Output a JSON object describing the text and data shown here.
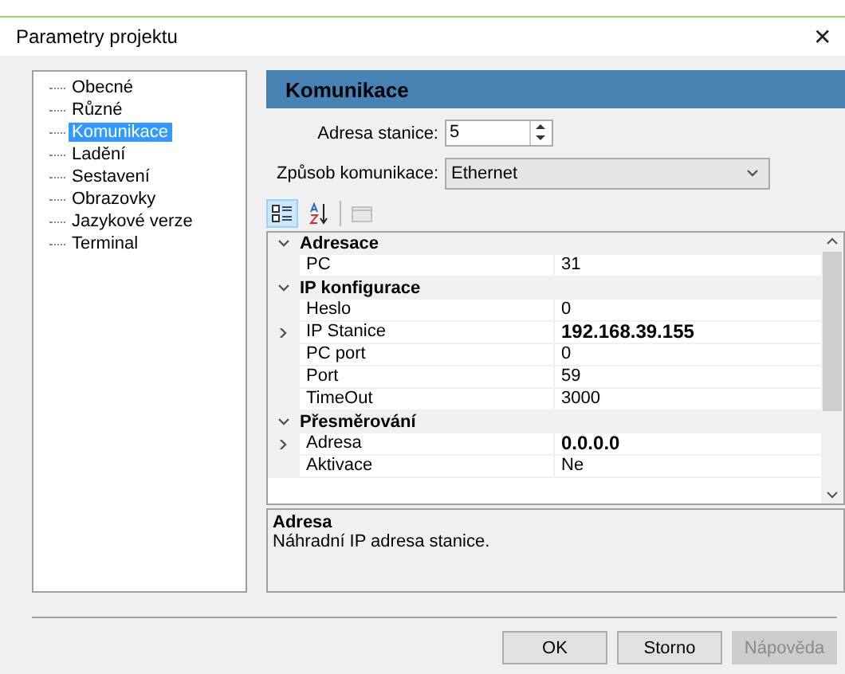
{
  "window": {
    "title": "Parametry projektu",
    "close": "✕"
  },
  "sidebar": {
    "items": [
      {
        "label": "Obecné",
        "selected": false
      },
      {
        "label": "Různé",
        "selected": false
      },
      {
        "label": "Komunikace",
        "selected": true
      },
      {
        "label": "Ladění",
        "selected": false
      },
      {
        "label": "Sestavení",
        "selected": false
      },
      {
        "label": "Obrazovky",
        "selected": false
      },
      {
        "label": "Jazykové verze",
        "selected": false
      },
      {
        "label": "Terminal",
        "selected": false
      }
    ]
  },
  "header": "Komunikace",
  "station_address": {
    "label": "Adresa stanice:",
    "value": "5"
  },
  "comm_mode": {
    "label": "Způsob komunikace:",
    "value": "Ethernet"
  },
  "toolbar": [
    {
      "kind": "categorized",
      "selected": true,
      "disabled": false
    },
    {
      "kind": "alphabetical",
      "selected": false,
      "disabled": false
    },
    {
      "kind": "pages",
      "selected": false,
      "disabled": true
    }
  ],
  "grid": {
    "categories": [
      {
        "name": "Adresace",
        "expanded": true,
        "properties": [
          {
            "name": "PC",
            "value": "31",
            "modified": false,
            "has_children": false
          }
        ]
      },
      {
        "name": "IP konfigurace",
        "expanded": true,
        "properties": [
          {
            "name": "Heslo",
            "value": "0",
            "modified": false,
            "has_children": false
          },
          {
            "name": "IP Stanice",
            "value": "192.168.39.155",
            "modified": true,
            "has_children": true
          },
          {
            "name": "PC port",
            "value": "0",
            "modified": false,
            "has_children": false
          },
          {
            "name": "Port",
            "value": "59",
            "modified": false,
            "has_children": false
          },
          {
            "name": "TimeOut",
            "value": "3000",
            "modified": false,
            "has_children": false
          }
        ]
      },
      {
        "name": "Přesměrování",
        "expanded": true,
        "properties": [
          {
            "name": "Adresa",
            "value": "0.0.0.0",
            "modified": true,
            "has_children": true
          },
          {
            "name": "Aktivace",
            "value": "Ne",
            "modified": false,
            "has_children": false
          }
        ]
      }
    ]
  },
  "description": {
    "title": "Adresa",
    "text": "Náhradní IP adresa stanice."
  },
  "buttons": [
    {
      "label": "OK",
      "disabled": false
    },
    {
      "label": "Storno",
      "disabled": false
    },
    {
      "label": "Nápověda",
      "disabled": true
    }
  ]
}
